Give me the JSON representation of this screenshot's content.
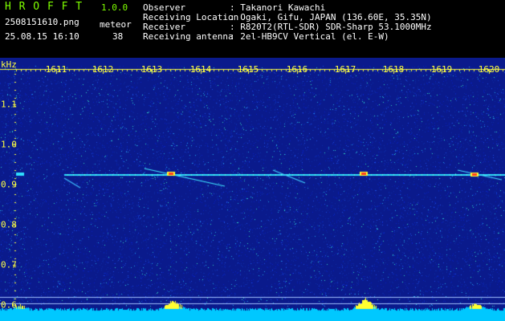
{
  "app": {
    "logo": "H R O F F T",
    "version": "1.0.0",
    "filename": "2508151610.png",
    "datetime": "25.08.15 16:10",
    "counter_label": "meteor",
    "counter_value": "38"
  },
  "info": {
    "observer_label": "Observer",
    "observer_value": ": Takanori Kawachi",
    "location_label": "Receiving Location",
    "location_value": ": Ogaki, Gifu, JAPAN (136.60E, 35.35N)",
    "receiver_label": "Receiver",
    "receiver_value": ": R820T2(RTL-SDR) SDR-Sharp 53.1000MHz",
    "antenna_label": "Receiving antenna",
    "antenna_value": ": 2el-HB9CV Vertical (el. E-W)"
  },
  "axes": {
    "y_unit": "kHz",
    "time_ticks": [
      "1611",
      "1612",
      "1613",
      "1614",
      "1615",
      "1616",
      "1617",
      "1618",
      "1619",
      "1620"
    ],
    "freq_ticks": [
      "1.1",
      "1.0",
      "0.9",
      "0.8",
      "0.7",
      "0.6"
    ]
  },
  "colors": {
    "background": "#000000",
    "spectrum_base": "#0a1a8c",
    "header_green": "#7fff00",
    "tick_yellow": "#ffff40"
  }
}
